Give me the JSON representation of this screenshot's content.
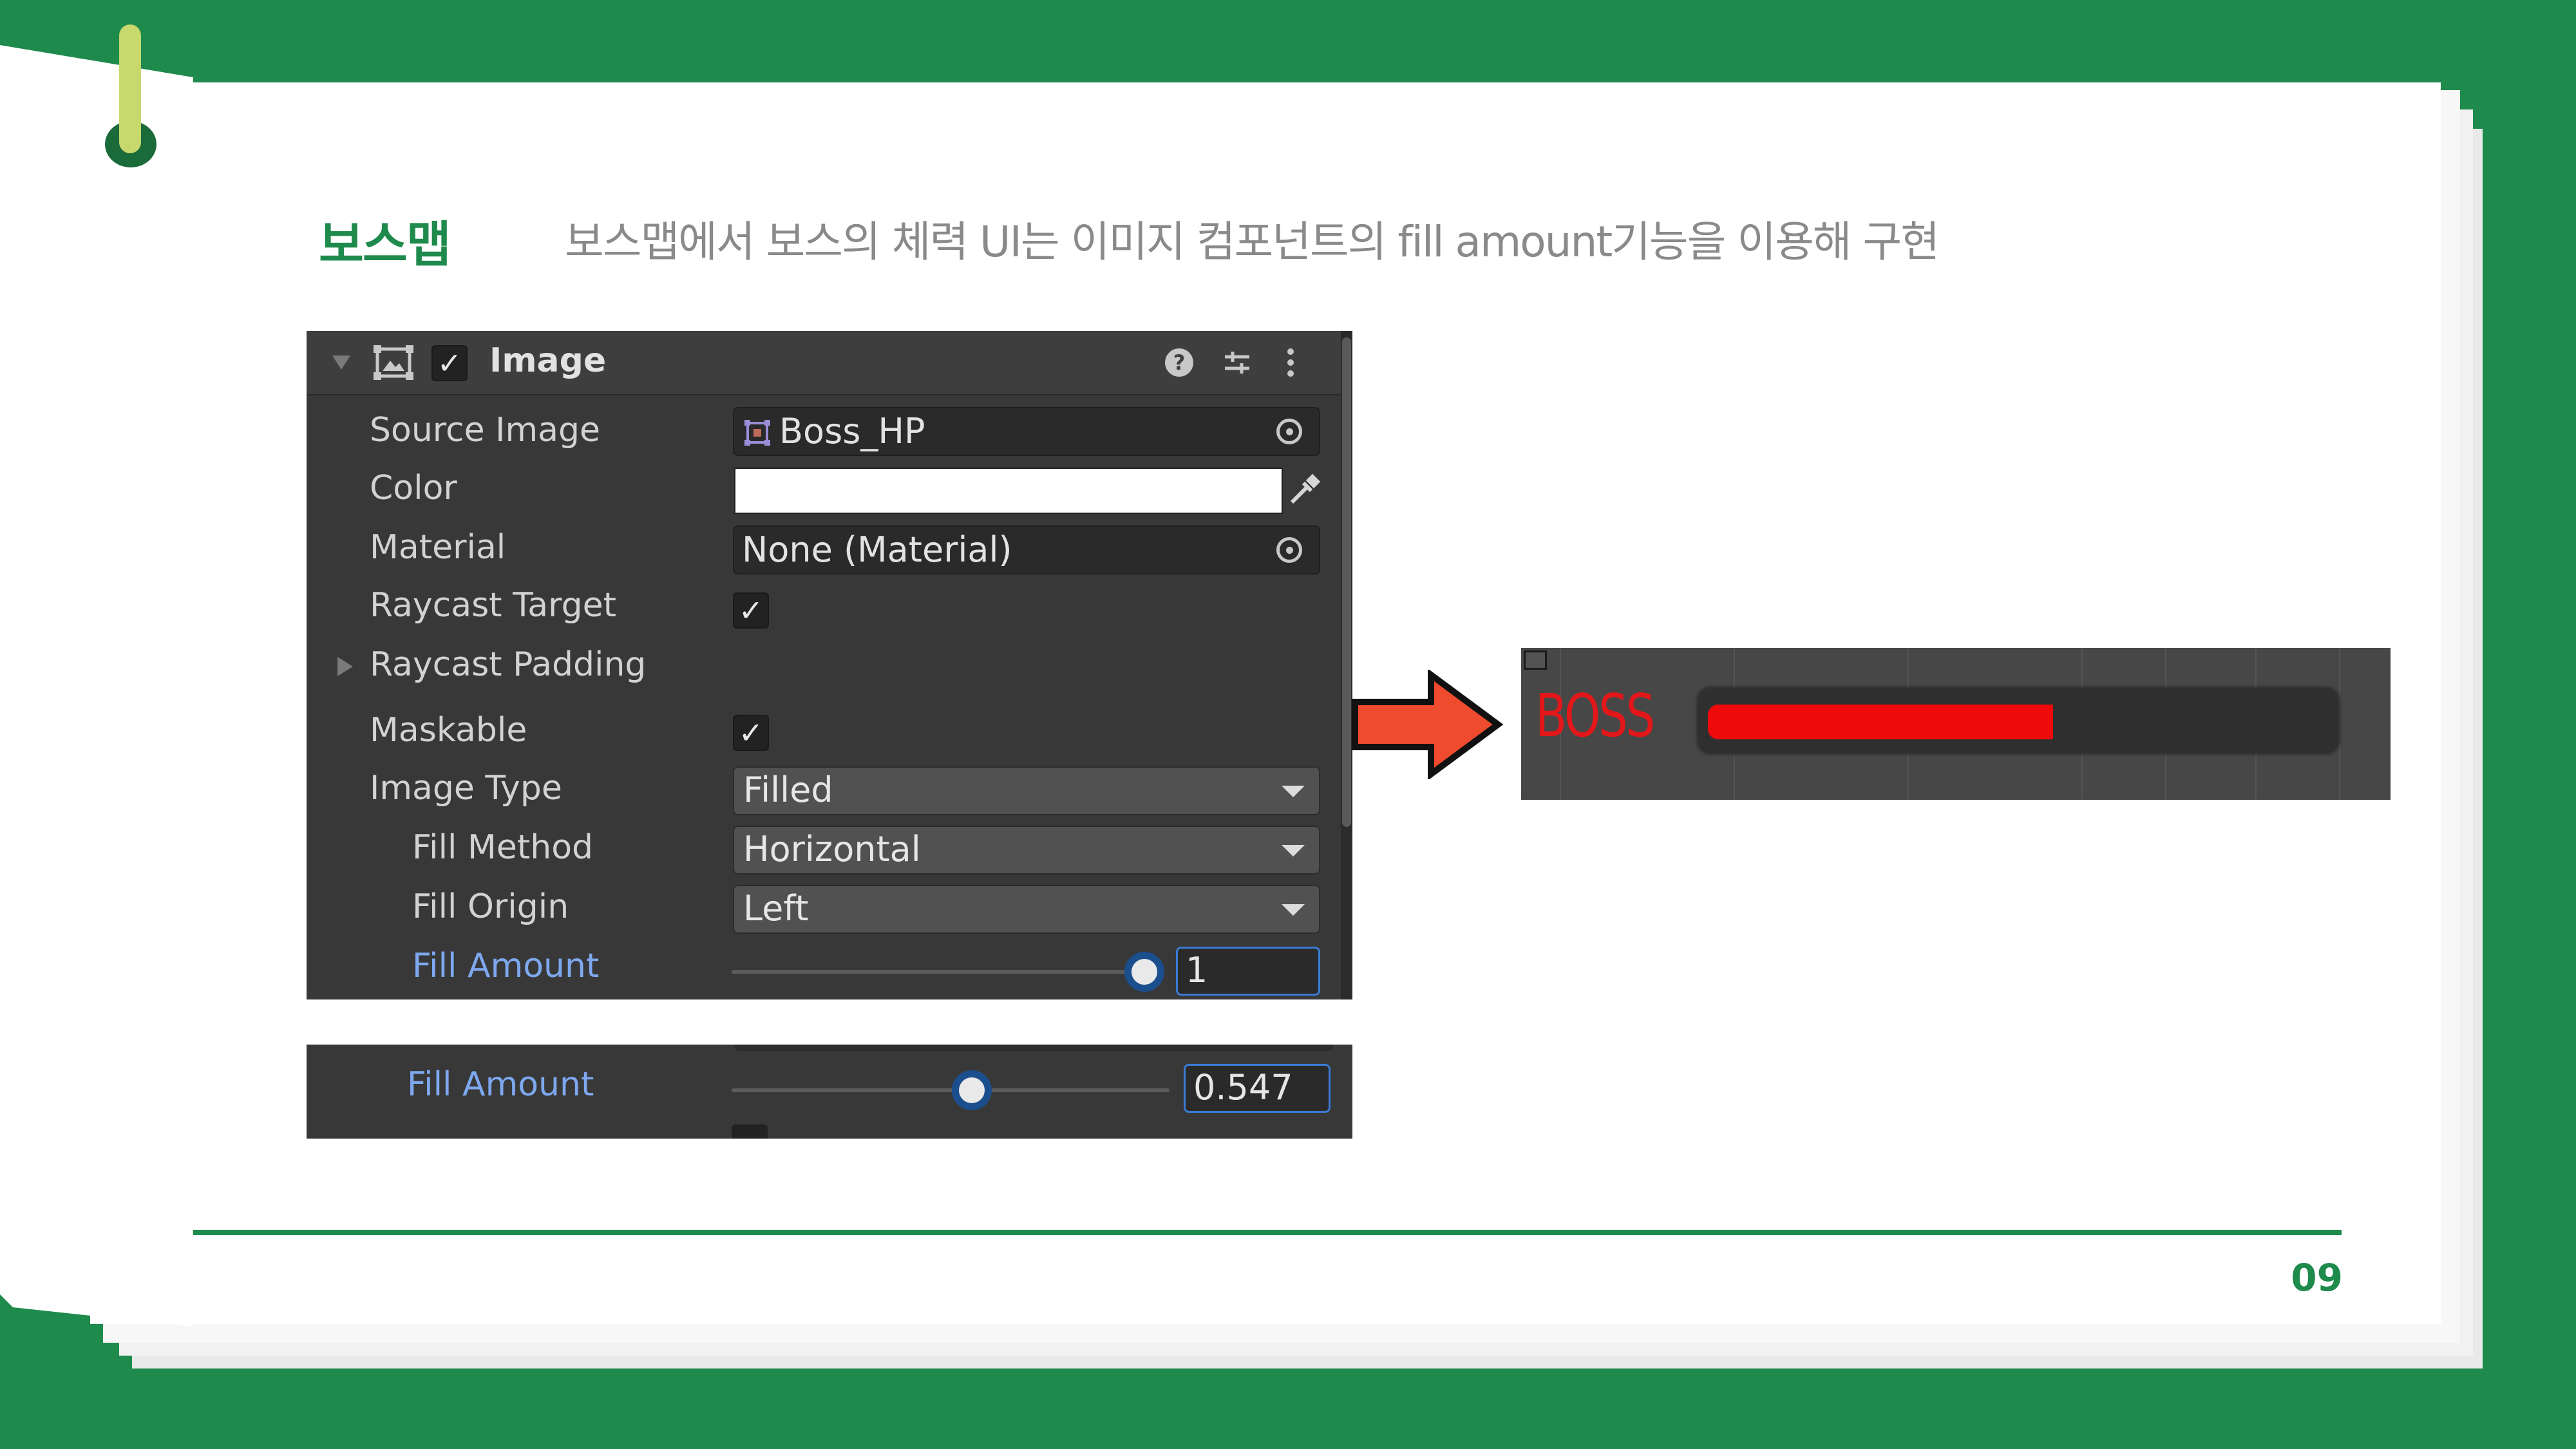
{
  "slide": {
    "title": "보스맵",
    "description": "보스맵에서 보스의 체력 UI는 이미지 컴포넌트의 fill amount기능을 이용해 구현",
    "page_number": "09"
  },
  "inspector": {
    "component_title": "Image",
    "fields": {
      "source_image_label": "Source Image",
      "source_image_value": "Boss_HP",
      "color_label": "Color",
      "color_value": "#ffffff",
      "material_label": "Material",
      "material_value": "None (Material)",
      "raycast_target_label": "Raycast Target",
      "raycast_padding_label": "Raycast Padding",
      "maskable_label": "Maskable",
      "image_type_label": "Image Type",
      "image_type_value": "Filled",
      "fill_method_label": "Fill Method",
      "fill_method_value": "Horizontal",
      "fill_origin_label": "Fill Origin",
      "fill_origin_value": "Left",
      "fill_amount_label": "Fill Amount",
      "fill_amount_value": "1"
    },
    "checks": {
      "enabled": "✓",
      "raycast_target": "✓",
      "maskable": "✓"
    }
  },
  "inspector_detail": {
    "fill_amount_label": "Fill Amount",
    "fill_amount_value": "0.547"
  },
  "preview": {
    "boss_label": "BOSS",
    "hp_fill_fraction": 0.547,
    "hp_color": "#ee0a0a"
  },
  "colors": {
    "accent_green": "#1e8a4c",
    "arrow_fill": "#ef4b2e"
  },
  "icons": [
    "foldout-arrow-icon",
    "image-component-icon",
    "help-icon",
    "preset-icon",
    "more-options-icon",
    "object-picker-icon",
    "eyedropper-icon",
    "sprite-icon",
    "dropdown-caret-icon",
    "right-arrow-icon"
  ]
}
